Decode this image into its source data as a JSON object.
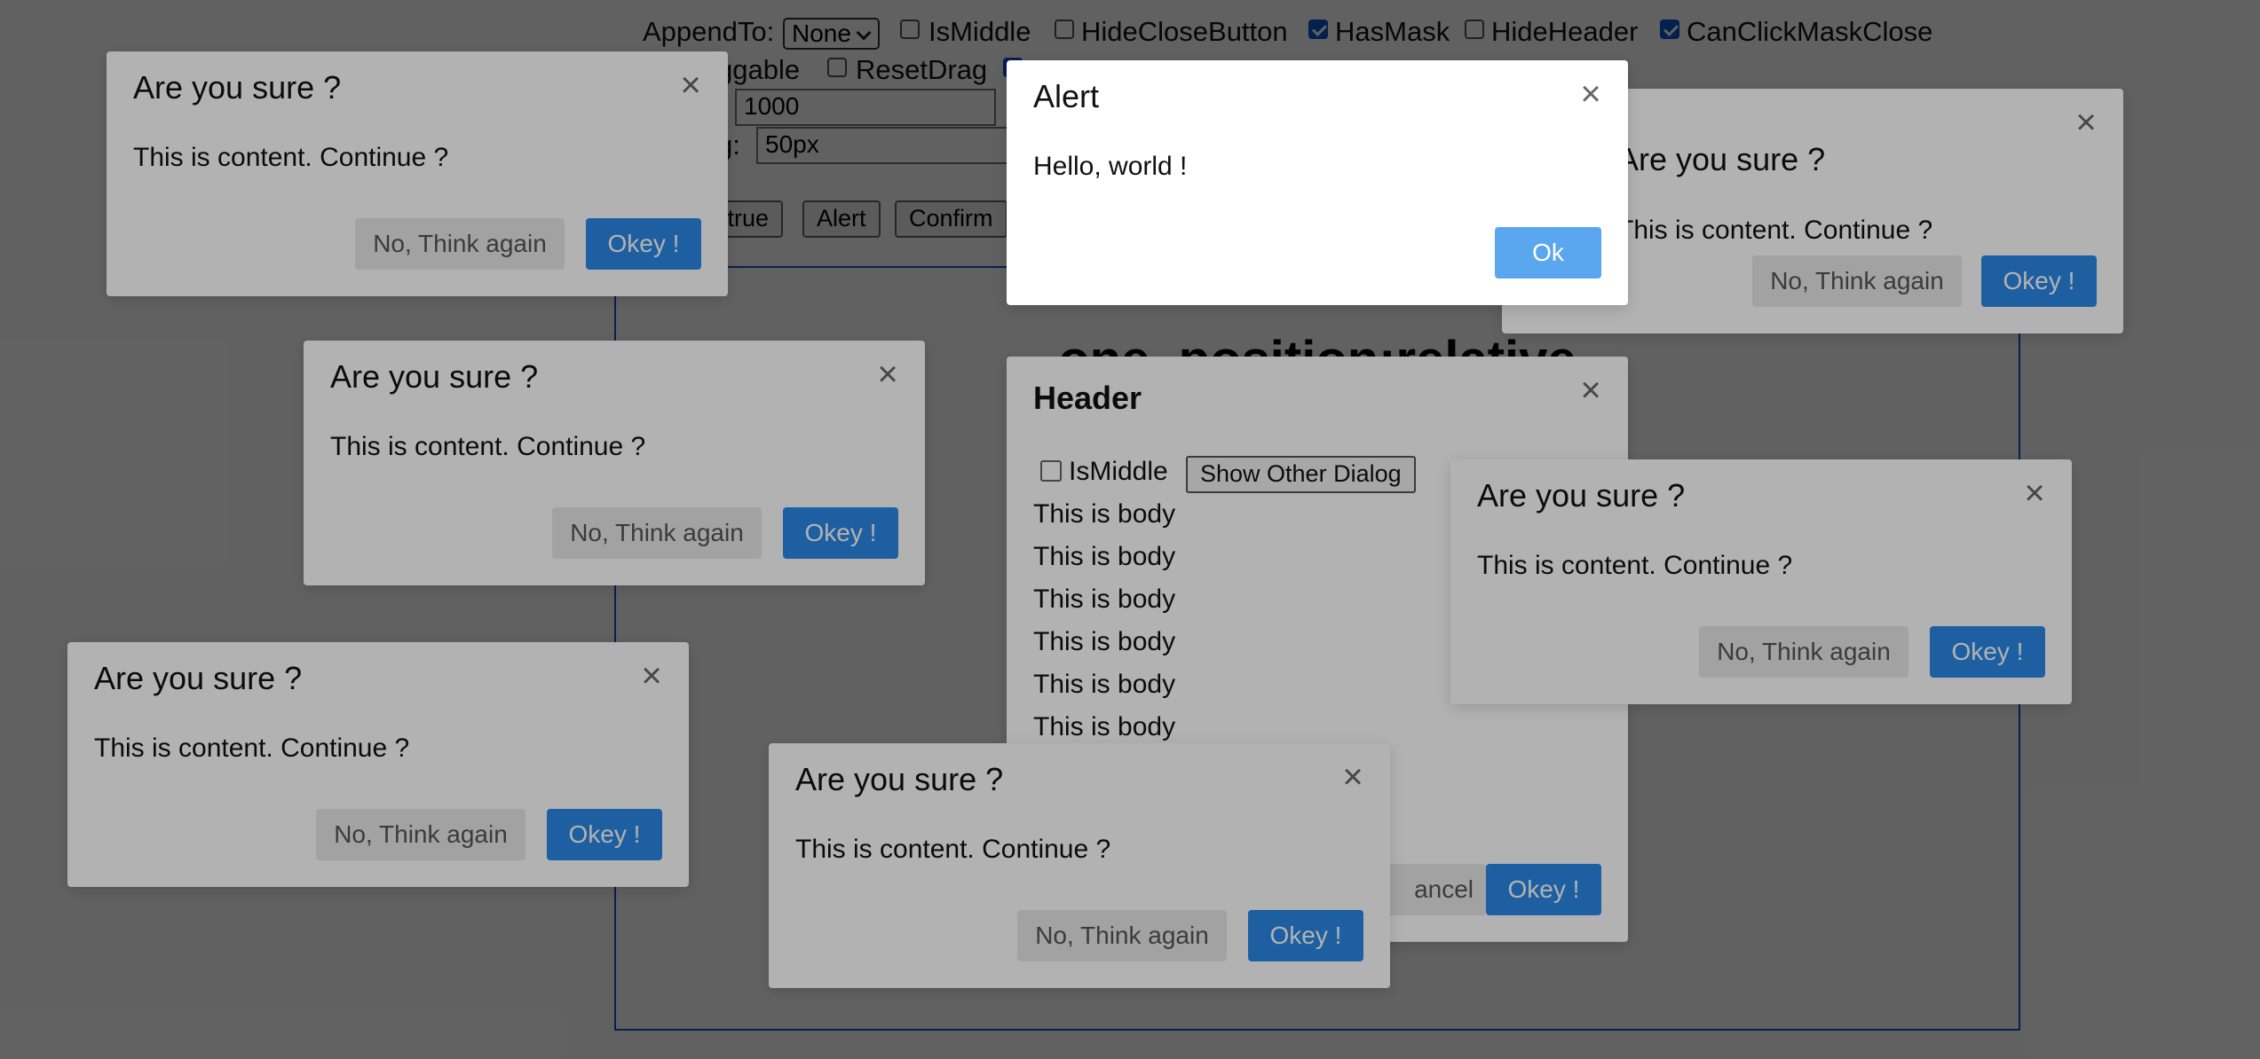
{
  "controls": {
    "append_to_label": "AppendTo:",
    "append_to_value": "None",
    "is_middle": "IsMiddle",
    "hide_close_button": "HideCloseButton",
    "has_mask": "HasMask",
    "hide_header": "HideHeader",
    "can_click_mask_close": "CanClickMaskClose",
    "draggable_partial": "ggable",
    "reset_drag": "ResetDrag",
    "zindex_value": "1000",
    "padding_label_partial": "g:",
    "padding_value": "50px",
    "btn_partial": "ctrue",
    "btn_alert": "Alert",
    "btn_confirm": "Confirm",
    "checked": {
      "has_mask": true,
      "can_click_mask_close": true
    }
  },
  "stage": {
    "title_partial": "one, position:relative"
  },
  "confirm": {
    "title": "Are you sure ?",
    "content": "This is content. Continue ?",
    "cancel": "No, Think again",
    "ok": "Okey !",
    "close": "×",
    "title_partial_right": "u sure ?",
    "content_partial_right": "content. Continue ?"
  },
  "alert": {
    "title": "Alert",
    "content": "Hello, world !",
    "ok": "Ok",
    "close": "×"
  },
  "header_dialog": {
    "title": "Header",
    "close": "×",
    "is_middle": "IsMiddle",
    "show_other": "Show Other Dialog",
    "body_line": "This is body",
    "cancel_partial": "ancel",
    "ok": "Okey !"
  },
  "colors": {
    "primary": "#2b89e8",
    "secondary_bg": "#e8e8e8",
    "stage_border": "#0b57d0"
  }
}
